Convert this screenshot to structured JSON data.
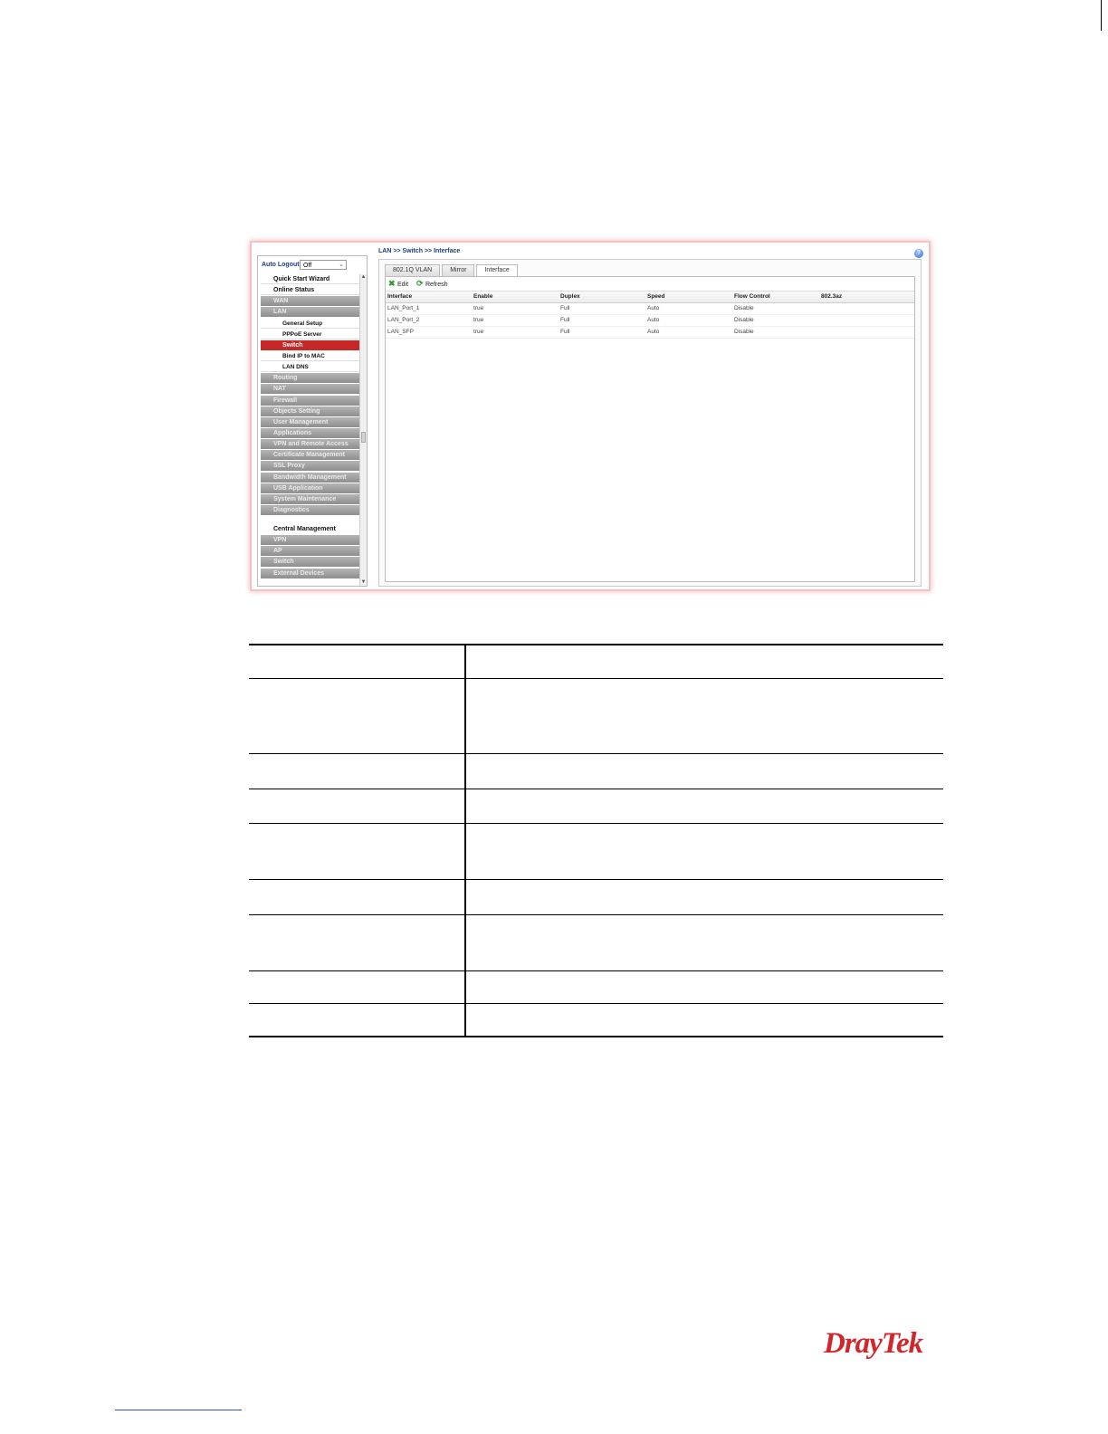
{
  "router_ui": {
    "sidebar": {
      "auto_logout_label": "Auto Logout",
      "auto_logout_value": "Off",
      "items": [
        {
          "label": "Quick Start Wizard",
          "style": "white"
        },
        {
          "label": "Online Status",
          "style": "white"
        },
        {
          "label": "WAN",
          "style": "grey"
        },
        {
          "label": "LAN",
          "style": "grey"
        },
        {
          "label": "General Setup",
          "style": "sub"
        },
        {
          "label": "PPPoE Server",
          "style": "sub"
        },
        {
          "label": "Switch",
          "style": "active"
        },
        {
          "label": "Bind IP to MAC",
          "style": "sub"
        },
        {
          "label": "LAN DNS",
          "style": "sub"
        },
        {
          "label": "Routing",
          "style": "grey"
        },
        {
          "label": "NAT",
          "style": "grey"
        },
        {
          "label": "Firewall",
          "style": "grey"
        },
        {
          "label": "Objects Setting",
          "style": "grey"
        },
        {
          "label": "User Management",
          "style": "grey"
        },
        {
          "label": "Applications",
          "style": "grey"
        },
        {
          "label": "VPN and Remote Access",
          "style": "grey"
        },
        {
          "label": "Certificate Management",
          "style": "grey"
        },
        {
          "label": "SSL Proxy",
          "style": "grey"
        },
        {
          "label": "Bandwidth Management",
          "style": "grey"
        },
        {
          "label": "USB Application",
          "style": "grey"
        },
        {
          "label": "System Maintenance",
          "style": "grey"
        },
        {
          "label": "Diagnostics",
          "style": "grey"
        },
        {
          "label": "Central Management",
          "style": "label"
        },
        {
          "label": "VPN",
          "style": "grey"
        },
        {
          "label": "AP",
          "style": "grey"
        },
        {
          "label": "Switch",
          "style": "grey"
        },
        {
          "label": "External Devices",
          "style": "grey"
        }
      ]
    },
    "breadcrumb": "LAN >> Switch >> Interface",
    "tabs": [
      "802.1Q VLAN",
      "Mirror",
      "Interface"
    ],
    "active_tab": 2,
    "toolbar": {
      "edit_label": "Edit",
      "refresh_label": "Refresh"
    },
    "table": {
      "columns": [
        "Interface",
        "Enable",
        "Duplex",
        "Speed",
        "Flow Control",
        "802.3az"
      ],
      "rows": [
        [
          "LAN_Port_1",
          "true",
          "Full",
          "Auto",
          "Disable",
          ""
        ],
        [
          "LAN_Port_2",
          "true",
          "Full",
          "Auto",
          "Disable",
          ""
        ],
        [
          "LAN_SFP",
          "true",
          "Full",
          "Auto",
          "Disable",
          ""
        ]
      ]
    }
  },
  "brand": {
    "logo_text_1": "Dray",
    "logo_text_2": "Tek",
    "color": "#d1262b"
  },
  "colors": {
    "active_menu": "#c62828",
    "menu_grey": "#9e9e9e",
    "link_blue": "#1c3d7c"
  }
}
